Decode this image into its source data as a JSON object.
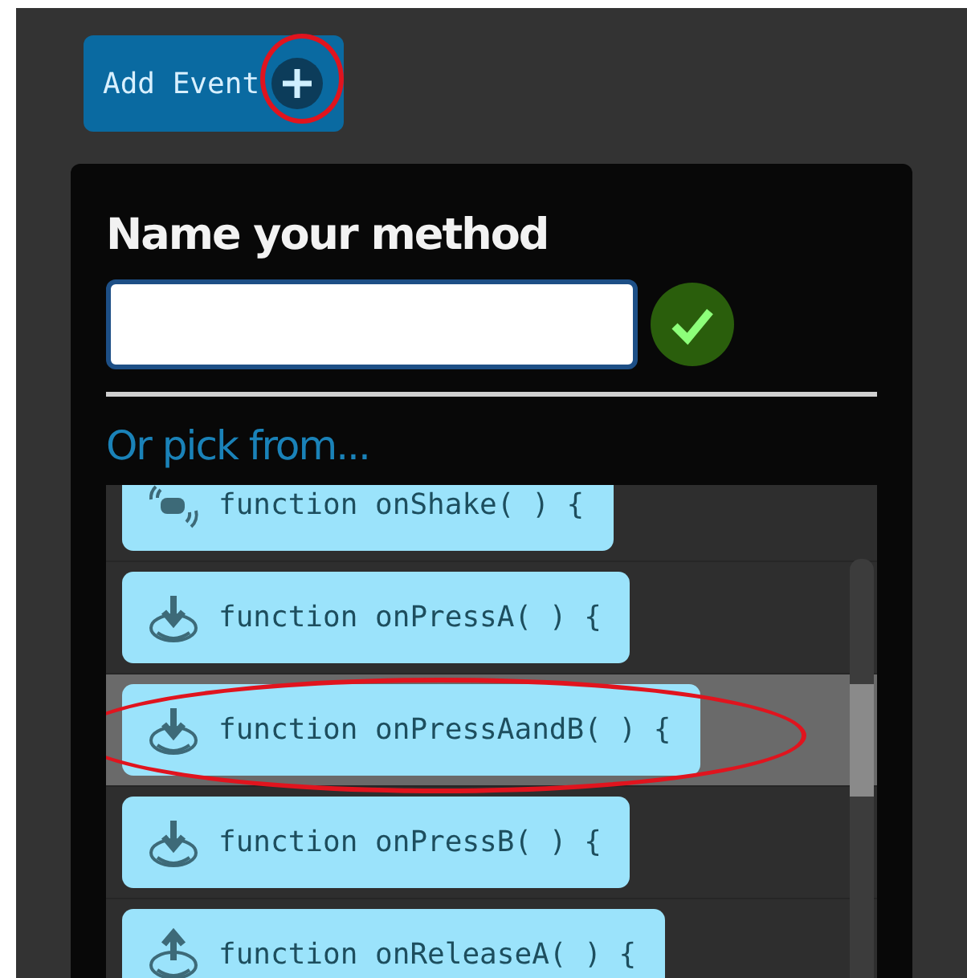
{
  "add_event_button": {
    "label": "Add Event",
    "plus_circled": true
  },
  "method_dialog": {
    "title": "Name your method",
    "pick_label": "Or pick from...",
    "events": [
      {
        "label": "function onShake( ) {",
        "kind": "shake",
        "selected": false,
        "circled": false
      },
      {
        "label": "function onPressA( ) {",
        "kind": "press",
        "selected": false,
        "circled": false
      },
      {
        "label": "function onPressAandB( ) {",
        "kind": "press",
        "selected": true,
        "circled": true
      },
      {
        "label": "function onPressB( ) {",
        "kind": "press",
        "selected": false,
        "circled": false
      },
      {
        "label": "function onReleaseA( ) {",
        "kind": "release",
        "selected": false,
        "circled": false
      }
    ]
  }
}
